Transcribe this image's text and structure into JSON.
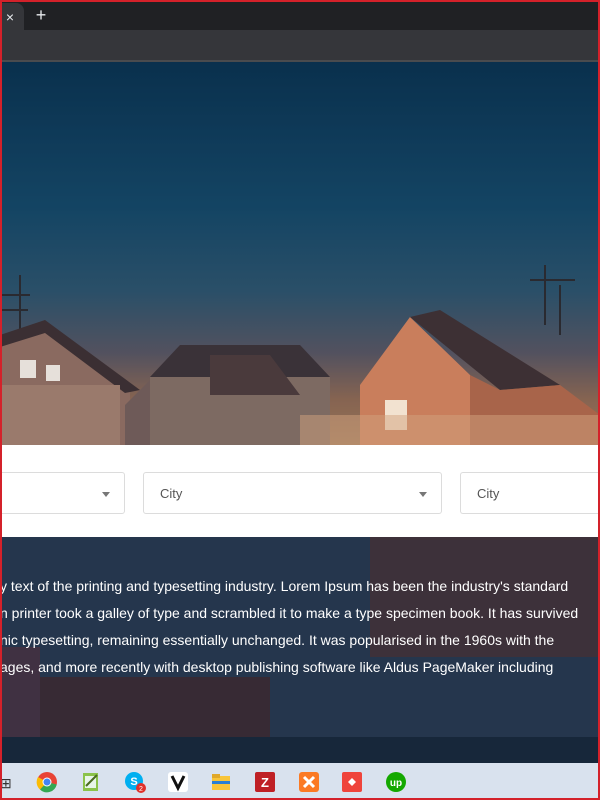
{
  "browser": {
    "tab_close_glyph": "×",
    "new_tab_glyph": "+"
  },
  "search": {
    "selects": [
      {
        "value": ""
      },
      {
        "value": "City"
      },
      {
        "value": "City"
      }
    ]
  },
  "content": {
    "paragraph_lines": [
      "y text of the printing and typesetting industry. Lorem Ipsum has been the industry's standard",
      "n printer took a galley of type and scrambled it to make a type specimen book. It has survived",
      "nic typesetting, remaining essentially unchanged. It was popularised in the 1960s with the",
      "ages, and more recently with desktop publishing software like Aldus PageMaker including"
    ]
  },
  "taskbar": {
    "icons": [
      "chrome-icon",
      "notepad-icon",
      "skype-icon",
      "vectary-icon",
      "file-explorer-icon",
      "filezilla-icon",
      "xampp-icon",
      "anydesk-icon",
      "upwork-icon"
    ],
    "skype_badge": "2",
    "colors": {
      "chrome": "#e84335",
      "filezilla": "#bf2025",
      "xampp": "#fb7a24",
      "anydesk": "#ef443b",
      "upwork": "#14a800"
    }
  }
}
